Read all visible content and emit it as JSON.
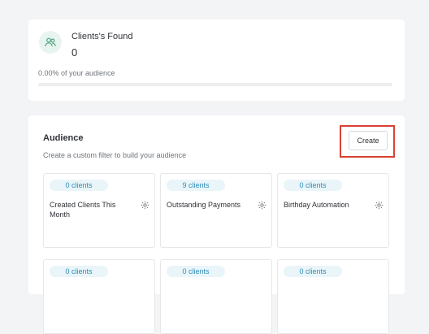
{
  "stats": {
    "title": "Clients's Found",
    "count": "0",
    "audience_percent": "0.00% of your audience",
    "progress_fraction": 0.0
  },
  "audience": {
    "title": "Audience",
    "subtitle": "Create a custom filter to build your audience",
    "create_label": "Create",
    "segments": [
      {
        "badge": "0 clients",
        "name": "Created Clients This Month"
      },
      {
        "badge": "9 clients",
        "name": "Outstanding Payments"
      },
      {
        "badge": "0 clients",
        "name": "Birthday Automation"
      },
      {
        "badge": "0 clients",
        "name": ""
      },
      {
        "badge": "0 clients",
        "name": ""
      },
      {
        "badge": "0 clients",
        "name": ""
      }
    ]
  },
  "colors": {
    "accent_green": "#5bb58b",
    "badge_blue": "#2f8db7",
    "highlight_red": "#d94234"
  },
  "icons": {
    "stats": "users-icon",
    "segment_settings": "gear-icon"
  }
}
